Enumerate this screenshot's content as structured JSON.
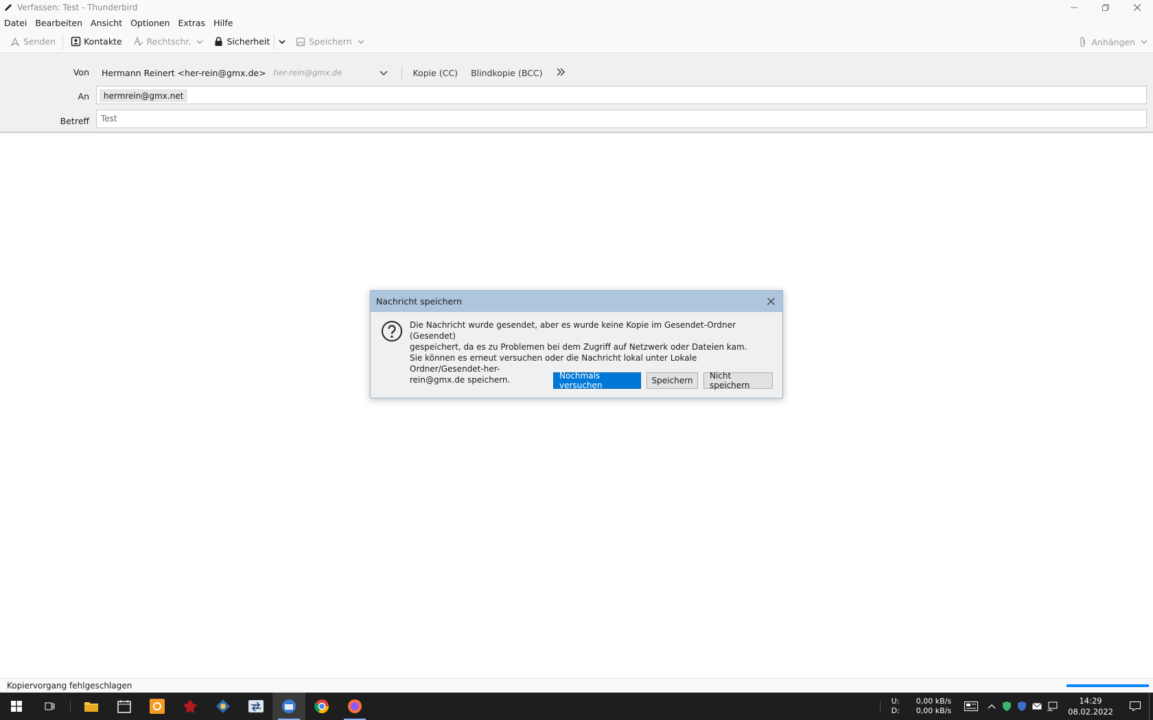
{
  "window": {
    "title": "Verfassen: Test - Thunderbird"
  },
  "menu": [
    "Datei",
    "Bearbeiten",
    "Ansicht",
    "Optionen",
    "Extras",
    "Hilfe"
  ],
  "toolbar": {
    "send": "Senden",
    "contacts": "Kontakte",
    "spelling": "Rechtschr.",
    "security": "Sicherheit",
    "save": "Speichern",
    "attach": "Anhängen"
  },
  "compose": {
    "from_label": "Von",
    "from_value": "Hermann Reinert <her-rein@gmx.de>",
    "from_hint": "her-rein@gmx.de",
    "cc_label": "Kopie (CC)",
    "bcc_label": "Blindkopie (BCC)",
    "to_label": "An",
    "to_recipient": "hermrein@gmx.net",
    "subject_label": "Betreff",
    "subject_value": "Test"
  },
  "dialog": {
    "title": "Nachricht speichern",
    "line1": "Die Nachricht wurde gesendet, aber es wurde keine Kopie im Gesendet-Ordner (Gesendet)",
    "line2": "gespeichert, da es zu Problemen bei dem Zugriff auf Netzwerk oder Dateien kam.",
    "line3": "Sie können es erneut versuchen oder die Nachricht lokal unter Lokale Ordner/Gesendet-her-",
    "line4": "rein@gmx.de speichern.",
    "retry": "Nochmals versuchen",
    "save": "Speichern",
    "dont_save": "Nicht speichern"
  },
  "status": {
    "text": "Kopiervorgang fehlgeschlagen",
    "progress": 1.0
  },
  "taskbar": {
    "net_up_label": "U:",
    "net_down_label": "D:",
    "net_up": "0,00 kB/s",
    "net_down": "0,00 kB/s",
    "time": "14:29",
    "date": "08.02.2022"
  }
}
